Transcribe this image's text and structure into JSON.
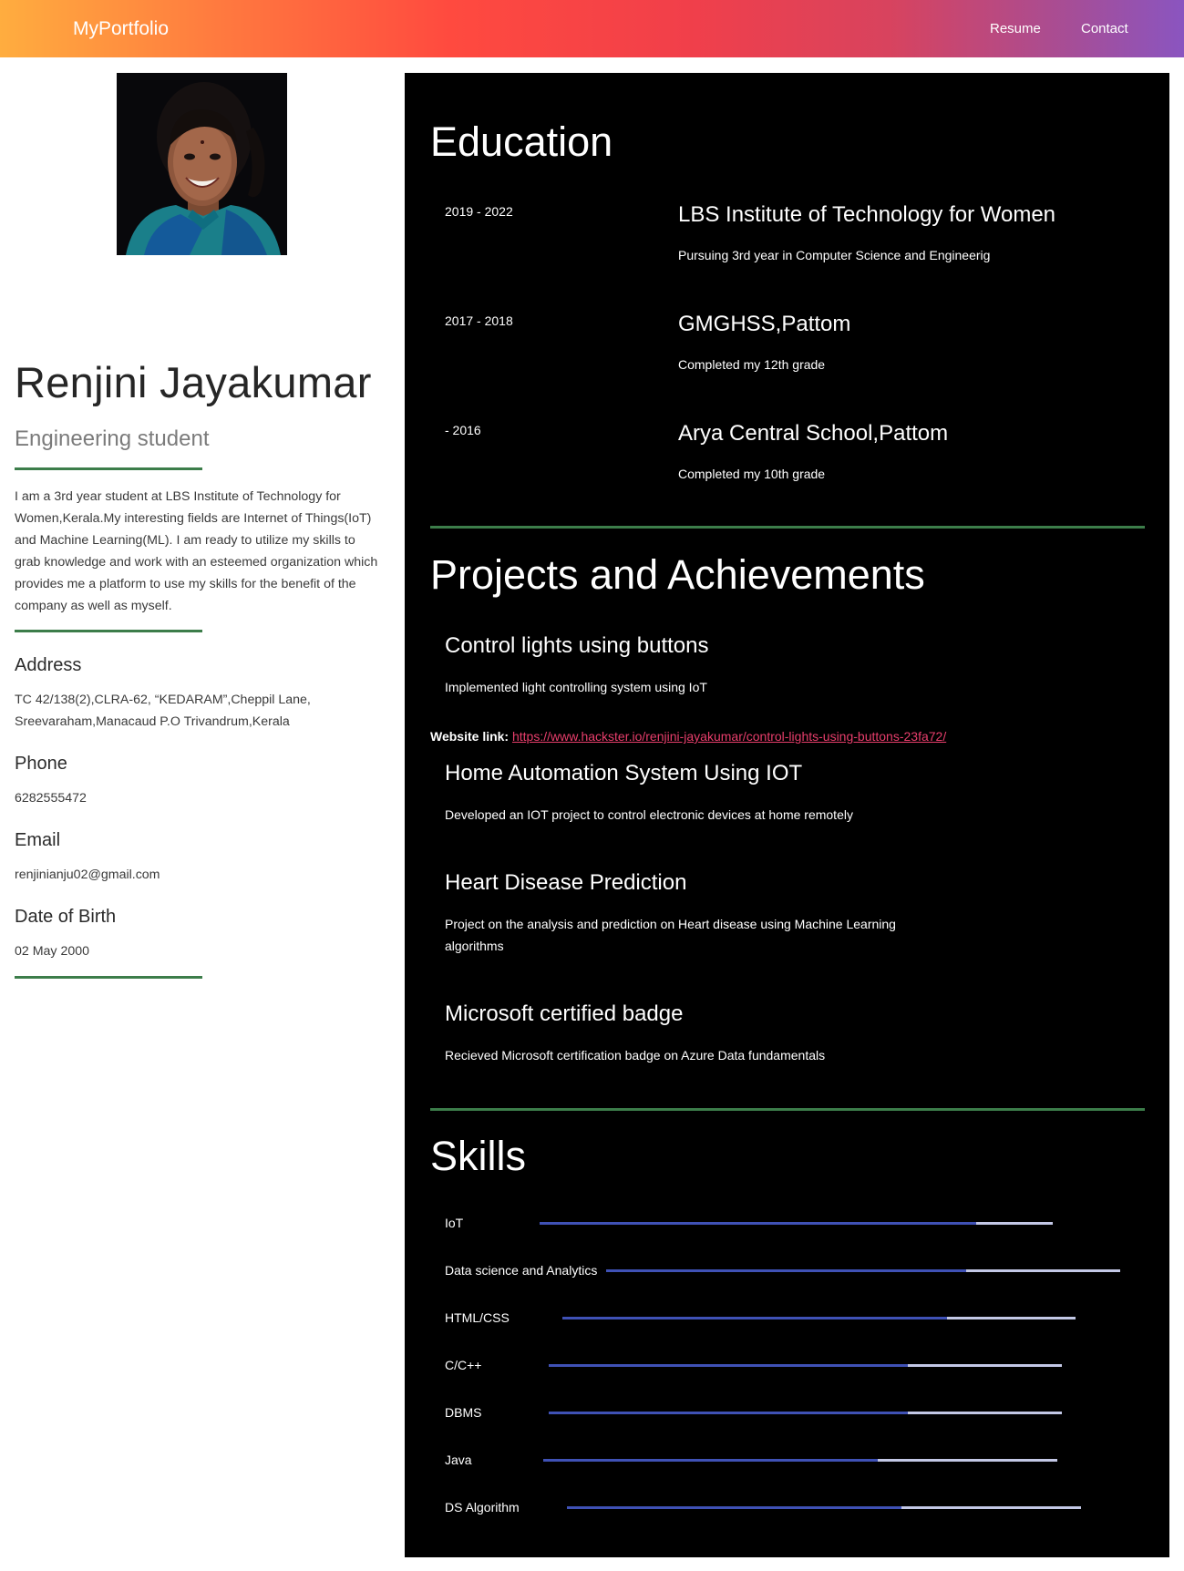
{
  "nav": {
    "brand": "MyPortfolio",
    "links": [
      "Resume",
      "Contact"
    ]
  },
  "profile": {
    "name": "Renjini Jayakumar",
    "role": "Engineering student",
    "about": "I am a 3rd year student at LBS Institute of Technology for Women,Kerala.My interesting fields are Internet of Things(IoT) and Machine Learning(ML). I am ready to utilize my skills to grab knowledge and work with an esteemed organization which provides me a platform to use my skills for the benefit of the company as well as myself.",
    "address_label": "Address",
    "address": "TC 42/138(2),CLRA-62, “KEDARAM”,Cheppil Lane, Sreevaraham,Manacaud P.O Trivandrum,Kerala",
    "phone_label": "Phone",
    "phone": "6282555472",
    "email_label": "Email",
    "email": "renjinianju02@gmail.com",
    "dob_label": "Date of Birth",
    "dob": "02 May 2000"
  },
  "education": {
    "title": "Education",
    "items": [
      {
        "years": "2019 - 2022",
        "school": "LBS Institute of Technology for Women",
        "desc": "Pursuing 3rd year in Computer Science and Engineerig"
      },
      {
        "years": "2017 - 2018",
        "school": "GMGHSS,Pattom",
        "desc": "Completed my 12th grade"
      },
      {
        "years": "- 2016",
        "school": "Arya Central School,Pattom",
        "desc": "Completed my 10th grade"
      }
    ]
  },
  "projects": {
    "title": "Projects and Achievements",
    "items": [
      {
        "title": "Control lights using buttons",
        "desc": "Implemented light controlling system using IoT"
      },
      {
        "title": "Home Automation System Using IOT",
        "desc": "Developed an IOT project to control electronic devices at home remotely"
      },
      {
        "title": "Heart Disease Prediction",
        "desc": "Project on the analysis and prediction on Heart disease using Machine Learning algorithms"
      },
      {
        "title": "Microsoft certified badge",
        "desc": "Recieved Microsoft certification badge on Azure Data fundamentals"
      }
    ],
    "link_label": "Website link:",
    "link_url": "https://www.hackster.io/renjini-jayakumar/control-lights-using-buttons-23fa72/"
  },
  "skills": {
    "title": "Skills",
    "items": [
      {
        "name": "IoT",
        "level": 0.85
      },
      {
        "name": "Data science and Analytics",
        "level": 0.7
      },
      {
        "name": "HTML/CSS",
        "level": 0.75
      },
      {
        "name": "C/C++",
        "level": 0.7
      },
      {
        "name": "DBMS",
        "level": 0.7
      },
      {
        "name": "Java",
        "level": 0.65
      },
      {
        "name": "DS Algorithm",
        "level": 0.65
      }
    ]
  },
  "colors": {
    "accent_rule": "#3c7d4a",
    "skill_fill": "#3f51b5",
    "skill_track": "#c3c8e6",
    "link": "#e83e6c"
  }
}
